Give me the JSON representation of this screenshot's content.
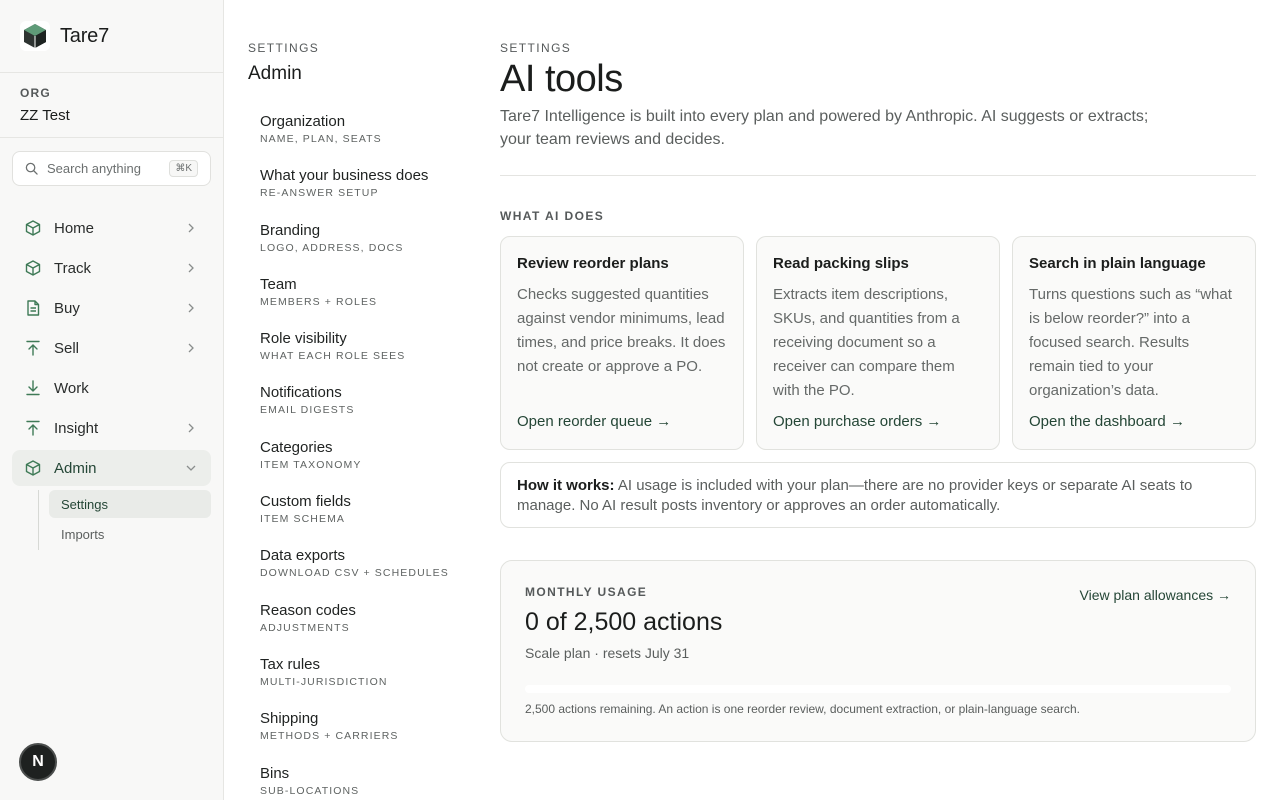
{
  "brand": {
    "name": "Tare7"
  },
  "org": {
    "label": "ORG",
    "name": "ZZ Test"
  },
  "search": {
    "placeholder": "Search anything",
    "shortcut": "⌘K"
  },
  "nav": {
    "items": [
      {
        "label": "Home",
        "icon": "box-icon"
      },
      {
        "label": "Track",
        "icon": "box-icon"
      },
      {
        "label": "Buy",
        "icon": "document-icon"
      },
      {
        "label": "Sell",
        "icon": "upload-icon"
      },
      {
        "label": "Work",
        "icon": "download-icon"
      },
      {
        "label": "Insight",
        "icon": "upload-icon"
      },
      {
        "label": "Admin",
        "icon": "box-icon"
      }
    ],
    "admin_sub": [
      {
        "label": "Settings"
      },
      {
        "label": "Imports"
      }
    ]
  },
  "user": {
    "initial": "N"
  },
  "settings": {
    "eyebrow": "SETTINGS",
    "title": "Admin",
    "items": [
      {
        "label": "Organization",
        "sub": "NAME, PLAN, SEATS"
      },
      {
        "label": "What your business does",
        "sub": "RE-ANSWER SETUP"
      },
      {
        "label": "Branding",
        "sub": "LOGO, ADDRESS, DOCS"
      },
      {
        "label": "Team",
        "sub": "MEMBERS + ROLES"
      },
      {
        "label": "Role visibility",
        "sub": "WHAT EACH ROLE SEES"
      },
      {
        "label": "Notifications",
        "sub": "EMAIL DIGESTS"
      },
      {
        "label": "Categories",
        "sub": "ITEM TAXONOMY"
      },
      {
        "label": "Custom fields",
        "sub": "ITEM SCHEMA"
      },
      {
        "label": "Data exports",
        "sub": "DOWNLOAD CSV + SCHEDULES"
      },
      {
        "label": "Reason codes",
        "sub": "ADJUSTMENTS"
      },
      {
        "label": "Tax rules",
        "sub": "MULTI-JURISDICTION"
      },
      {
        "label": "Shipping",
        "sub": "METHODS + CARRIERS"
      },
      {
        "label": "Bins",
        "sub": "SUB-LOCATIONS"
      }
    ]
  },
  "main": {
    "eyebrow": "SETTINGS",
    "title": "AI tools",
    "lede": "Tare7 Intelligence is built into every plan and powered by Anthropic. AI suggests or extracts; your team reviews and decides.",
    "section_label": "WHAT AI DOES",
    "cards": [
      {
        "title": "Review reorder plans",
        "body": "Checks suggested quantities against vendor minimums, lead times, and price breaks. It does not create or approve a PO.",
        "link": "Open reorder queue →"
      },
      {
        "title": "Read packing slips",
        "body": "Extracts item descriptions, SKUs, and quantities from a receiving document so a receiver can compare them with the PO.",
        "link": "Open purchase orders →"
      },
      {
        "title": "Search in plain language",
        "body": "Turns questions such as “what is below reorder?” into a focused search. Results remain tied to your organization’s data.",
        "link": "Open the dashboard →"
      }
    ],
    "how": {
      "lead": "How it works:",
      "text": " AI usage is included with your plan—there are no provider keys or separate AI seats to manage. No AI result posts inventory or approves an order automatically."
    },
    "usage": {
      "eyebrow": "MONTHLY USAGE",
      "count": "0 of 2,500 actions",
      "plan": "Scale plan · resets July 31",
      "link": "View plan allowances →",
      "used_fraction": 0,
      "note": "2,500 actions remaining. An action is one reorder review, document extraction, or plain-language search."
    }
  },
  "colors": {
    "accent": "#244636",
    "sidebar_bg": "#f8f8f7",
    "icon": "#3f7a57"
  }
}
